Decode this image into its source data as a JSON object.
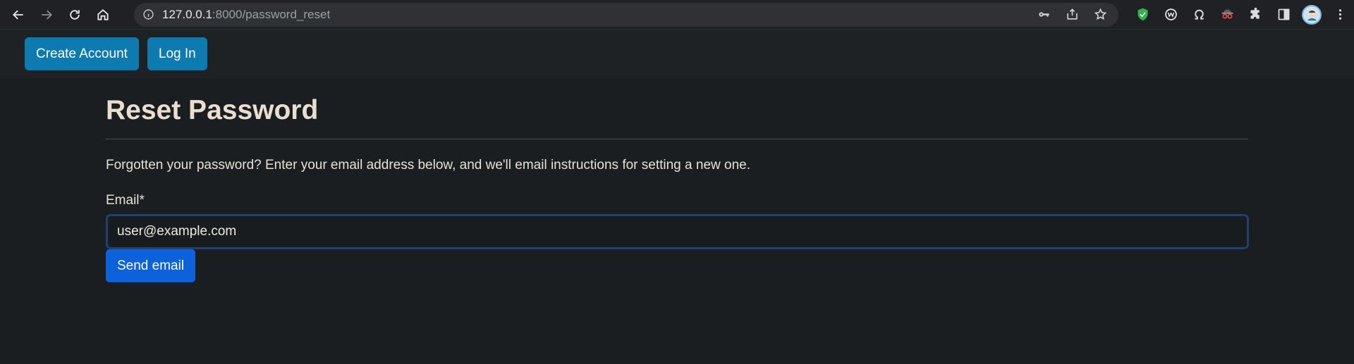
{
  "browser": {
    "url_host": "127.0.0.1",
    "url_rest": ":8000/password_reset",
    "icons": [
      "back-icon",
      "forward-icon",
      "reload-icon",
      "home-icon",
      "site-info-icon",
      "key-icon",
      "share-icon",
      "star-icon",
      "shield-extension-icon",
      "w-extension-icon",
      "omega-extension-icon",
      "spy-extension-icon",
      "puzzle-icon",
      "sidepanel-icon",
      "avatar",
      "kebab-menu-icon"
    ]
  },
  "nav": {
    "create_account": "Create Account",
    "log_in": "Log In"
  },
  "page": {
    "title": "Reset Password",
    "intro": "Forgotten your password? Enter your email address below, and we'll email instructions for setting a new one.",
    "email_label": "Email*",
    "email_value": "user@example.com",
    "submit_label": "Send email"
  },
  "colors": {
    "nav_button": "#0e7bb0",
    "primary_button": "#0d62dc",
    "background": "#1b1e20"
  }
}
